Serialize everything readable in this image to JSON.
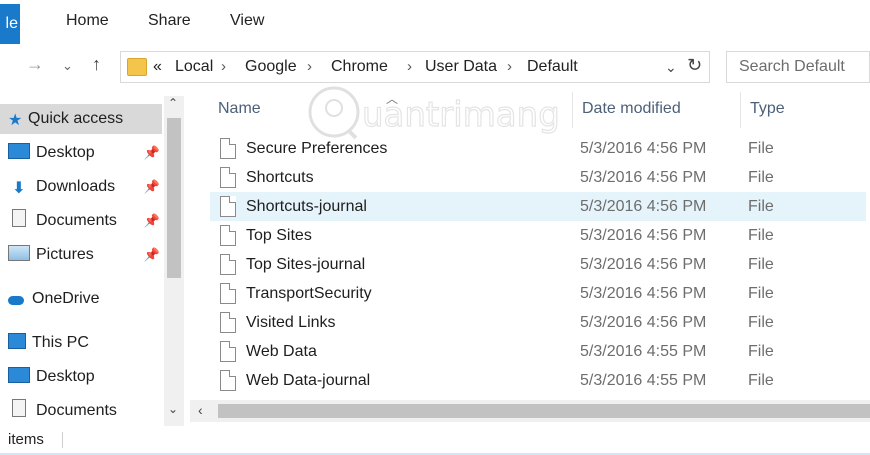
{
  "ribbon": {
    "file_tab": "le",
    "tabs": [
      {
        "label": "Home"
      },
      {
        "label": "Share"
      },
      {
        "label": "View"
      }
    ]
  },
  "nav": {
    "back_icon": "arrow-left-icon",
    "forward_icon": "chevron-down-icon",
    "up_icon": "arrow-up-icon"
  },
  "address": {
    "overflow": "«",
    "crumbs": [
      "Local",
      "Google",
      "Chrome",
      "User Data",
      "Default"
    ]
  },
  "search": {
    "placeholder": "Search Default"
  },
  "nav_pane": {
    "items": [
      {
        "label": "Quick access"
      },
      {
        "label": "Desktop"
      },
      {
        "label": "Downloads"
      },
      {
        "label": "Documents"
      },
      {
        "label": "Pictures"
      },
      {
        "label": "OneDrive"
      },
      {
        "label": "This PC"
      },
      {
        "label": "Desktop"
      },
      {
        "label": "Documents"
      }
    ]
  },
  "columns": {
    "name": "Name",
    "date": "Date modified",
    "type": "Type"
  },
  "files": [
    {
      "name": "Secure Preferences",
      "date": "5/3/2016 4:56 PM",
      "type": "File"
    },
    {
      "name": "Shortcuts",
      "date": "5/3/2016 4:56 PM",
      "type": "File"
    },
    {
      "name": "Shortcuts-journal",
      "date": "5/3/2016 4:56 PM",
      "type": "File"
    },
    {
      "name": "Top Sites",
      "date": "5/3/2016 4:56 PM",
      "type": "File"
    },
    {
      "name": "Top Sites-journal",
      "date": "5/3/2016 4:56 PM",
      "type": "File"
    },
    {
      "name": "TransportSecurity",
      "date": "5/3/2016 4:56 PM",
      "type": "File"
    },
    {
      "name": "Visited Links",
      "date": "5/3/2016 4:56 PM",
      "type": "File"
    },
    {
      "name": "Web Data",
      "date": "5/3/2016 4:55 PM",
      "type": "File"
    },
    {
      "name": "Web Data-journal",
      "date": "5/3/2016 4:55 PM",
      "type": "File"
    }
  ],
  "status": {
    "text": "items"
  },
  "watermark": {
    "text": "uantrimang"
  },
  "colors": {
    "accent": "#1979ca",
    "selection": "#d9d9d9",
    "hover_row": "#e5f3fb",
    "folder": "#f3c54a",
    "header_text": "#4c607a"
  }
}
